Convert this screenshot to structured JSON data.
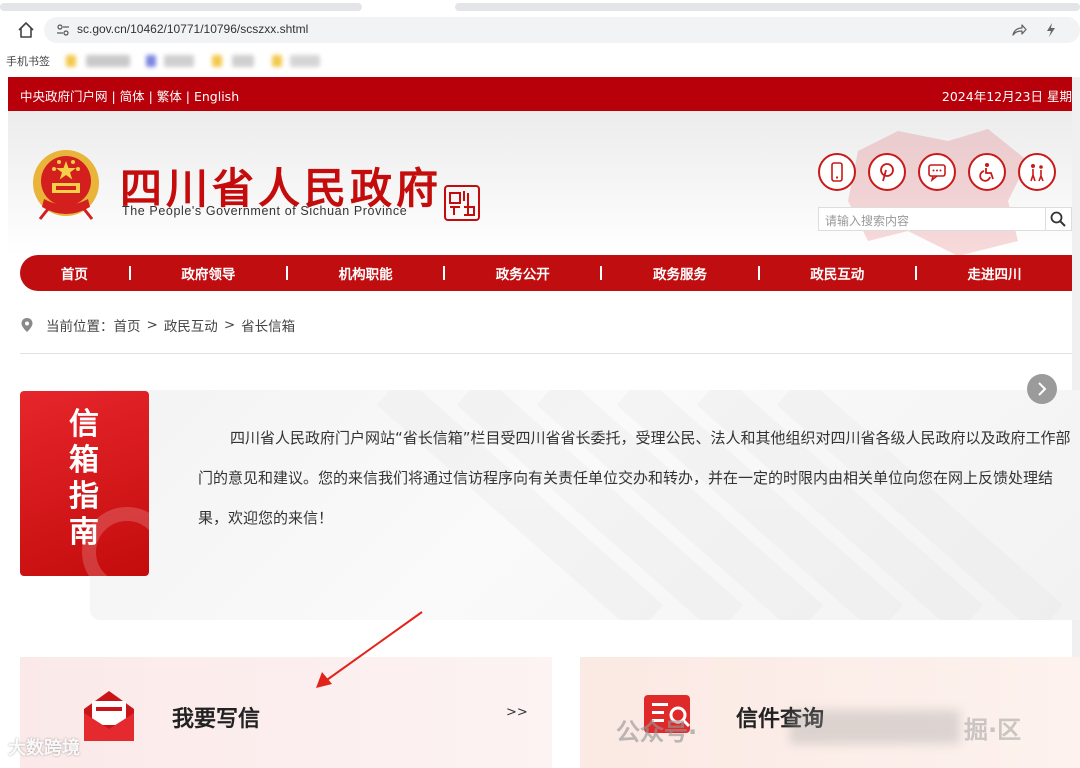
{
  "browser": {
    "url": "sc.gov.cn/10462/10771/10796/scszxx.shtml",
    "bookmarks_label": "手机书签"
  },
  "topbar": {
    "links": "中央政府门户网 | 简体 | 繁体 | English",
    "date": "2024年12月23日 星期"
  },
  "header": {
    "title": "四川省人民政府",
    "subtitle": "The People's Government of Sichuan Province",
    "search_placeholder": "请输入搜索内容",
    "tools": [
      "mobile-icon",
      "weibo-icon",
      "wechat-icon",
      "accessibility-icon",
      "elderly-icon"
    ]
  },
  "nav": {
    "items": [
      "首页",
      "政府领导",
      "机构职能",
      "政务公开",
      "政务服务",
      "政民互动",
      "走进四川"
    ]
  },
  "breadcrumb": {
    "prefix": "当前位置：",
    "items": [
      "首页",
      "政民互动",
      "省长信箱"
    ],
    "sep": ">"
  },
  "guide": {
    "badge": "信箱指南",
    "text": "四川省人民政府门户网站“省长信箱”栏目受四川省省长委托，受理公民、法人和其他组织对四川省各级人民政府以及政府工作部门的意见和建议。您的来信我们将通过信访程序向有关责任单位交办和转办，并在一定的时限内由相关单位向您在网上反馈处理结果，欢迎您的来信！"
  },
  "cards": {
    "write": {
      "title": "我要写信",
      "more": ">>"
    },
    "query": {
      "title": "信件查询"
    }
  },
  "watermark": {
    "left": "大数跨境",
    "right": "公众号·",
    "tail": "掘·区"
  },
  "colors": {
    "brand_red": "#c00d10",
    "title_red": "#c40c0c"
  }
}
